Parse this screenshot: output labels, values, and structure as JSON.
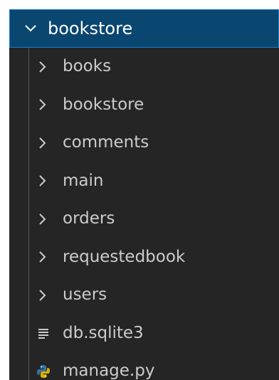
{
  "explorer": {
    "root": {
      "label": "bookstore",
      "expanded": true,
      "icon": "chevron-down-icon"
    },
    "items": [
      {
        "label": "books",
        "type": "folder",
        "icon": "chevron-right-icon"
      },
      {
        "label": "bookstore",
        "type": "folder",
        "icon": "chevron-right-icon"
      },
      {
        "label": "comments",
        "type": "folder",
        "icon": "chevron-right-icon"
      },
      {
        "label": "main",
        "type": "folder",
        "icon": "chevron-right-icon"
      },
      {
        "label": "orders",
        "type": "folder",
        "icon": "chevron-right-icon"
      },
      {
        "label": "requestedbook",
        "type": "folder",
        "icon": "chevron-right-icon"
      },
      {
        "label": "users",
        "type": "folder",
        "icon": "chevron-right-icon"
      },
      {
        "label": "db.sqlite3",
        "type": "file",
        "icon": "text-lines-icon"
      },
      {
        "label": "manage.py",
        "type": "file",
        "icon": "python-icon"
      }
    ],
    "colors": {
      "background": "#252526",
      "selected_background": "#094771",
      "selected_border": "#1f7ad1",
      "text": "#cccccc",
      "python_blue": "#3572a5",
      "python_yellow": "#d9b100"
    }
  }
}
